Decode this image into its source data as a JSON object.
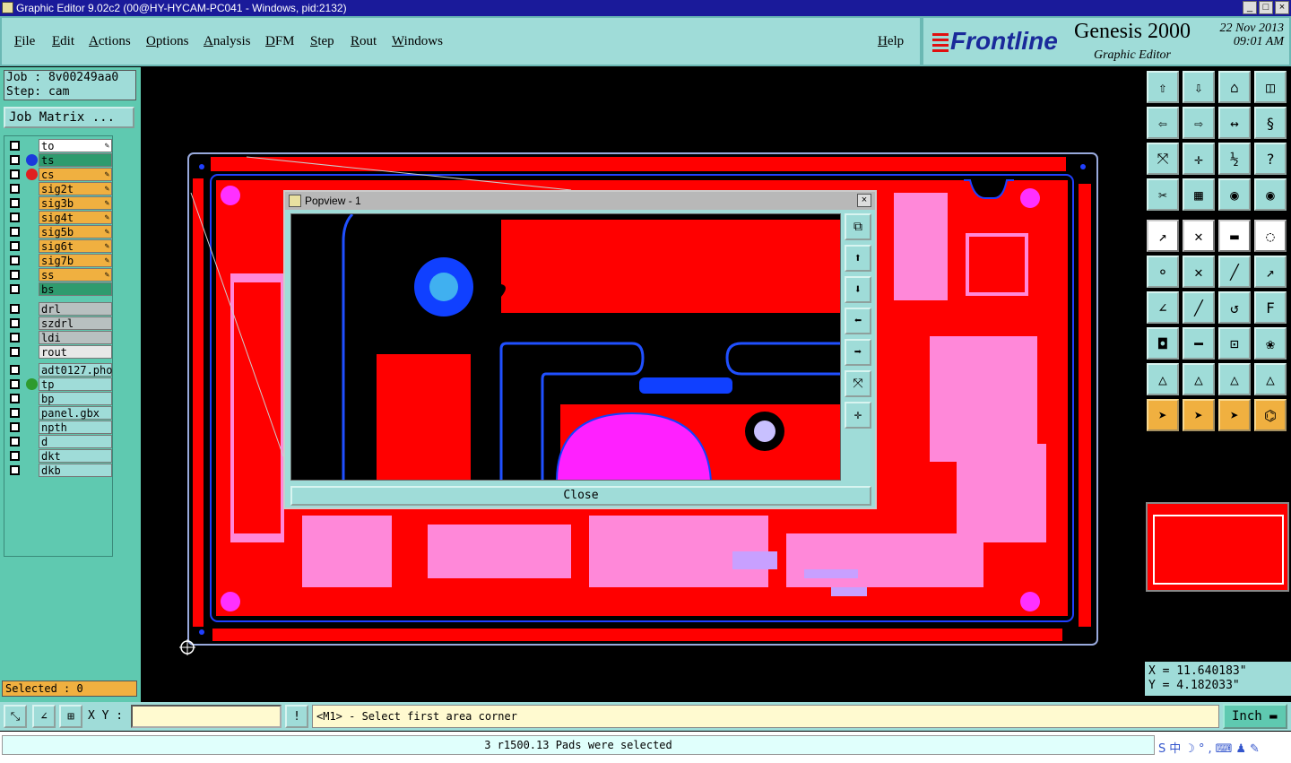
{
  "window": {
    "title": "Graphic Editor 9.02c2 (00@HY-HYCAM-PC041 - Windows, pid:2132)"
  },
  "menu": {
    "items": [
      "File",
      "Edit",
      "Actions",
      "Options",
      "Analysis",
      "DFM",
      "Step",
      "Rout",
      "Windows"
    ],
    "help": "Help"
  },
  "brand": {
    "logo": "Frontline",
    "product": "Genesis 2000",
    "subtitle": "Graphic Editor",
    "date_line1": "22 Nov 2013",
    "date_line2": "09:01 AM"
  },
  "job": {
    "job_line": "Job : 8v00249aa0",
    "step_line": "Step: cam",
    "matrix_button": "Job Matrix ..."
  },
  "layers": [
    {
      "name": "to",
      "color": "#ffffff",
      "dot": "",
      "flag": true
    },
    {
      "name": "ts",
      "color": "#2e9b6e",
      "dot": "#1a3adc",
      "flag": false
    },
    {
      "name": "cs",
      "color": "#f0b040",
      "dot": "#e02020",
      "flag": true
    },
    {
      "name": "sig2t",
      "color": "#f0b040",
      "dot": "",
      "flag": true
    },
    {
      "name": "sig3b",
      "color": "#f0b040",
      "dot": "",
      "flag": true
    },
    {
      "name": "sig4t",
      "color": "#f0b040",
      "dot": "",
      "flag": true
    },
    {
      "name": "sig5b",
      "color": "#f0b040",
      "dot": "",
      "flag": true
    },
    {
      "name": "sig6t",
      "color": "#f0b040",
      "dot": "",
      "flag": true
    },
    {
      "name": "sig7b",
      "color": "#f0b040",
      "dot": "",
      "flag": true
    },
    {
      "name": "ss",
      "color": "#f0b040",
      "dot": "",
      "flag": true
    },
    {
      "name": "bs",
      "color": "#2e9b6e",
      "dot": "",
      "flag": false
    },
    {
      "name": "drl",
      "color": "#b8c0c0",
      "dot": "",
      "flag": false
    },
    {
      "name": "szdrl",
      "color": "#b8c0c0",
      "dot": "",
      "flag": false
    },
    {
      "name": "ldi",
      "color": "#b8c0c0",
      "dot": "",
      "flag": false
    },
    {
      "name": "rout",
      "color": "#e8e8e8",
      "dot": "",
      "flag": false
    },
    {
      "name": "adt0127.pho",
      "color": "#9fdcd8",
      "dot": "",
      "flag": false
    },
    {
      "name": "tp",
      "color": "#9fdcd8",
      "dot": "#2e9b2e",
      "flag": false
    },
    {
      "name": "bp",
      "color": "#9fdcd8",
      "dot": "",
      "flag": false
    },
    {
      "name": "panel.gbx",
      "color": "#9fdcd8",
      "dot": "",
      "flag": false
    },
    {
      "name": "npth",
      "color": "#9fdcd8",
      "dot": "",
      "flag": false
    },
    {
      "name": "d",
      "color": "#9fdcd8",
      "dot": "",
      "flag": false
    },
    {
      "name": "dkt",
      "color": "#9fdcd8",
      "dot": "",
      "flag": false
    },
    {
      "name": "dkb",
      "color": "#9fdcd8",
      "dot": "",
      "flag": false
    }
  ],
  "selected": "Selected : 0",
  "popview": {
    "title": "Popview - 1",
    "close_label": "Close"
  },
  "coords": {
    "x": "X =  11.640183\"",
    "y": "Y =  4.182033\""
  },
  "bottom": {
    "xy_label": "X Y :",
    "prompt": "<M1> - Select first area corner",
    "unit": "Inch",
    "status": "3 r1500.13 Pads were selected"
  },
  "tools": [
    "home-icon",
    "save-view-icon",
    "house-icon",
    "split-icon",
    "arrow-left-icon",
    "arrow-right-icon",
    "swap-icon",
    "s-icon",
    "fit-icon",
    "center-icon",
    "ratio-icon",
    "help-icon",
    "tweezers-icon",
    "grid-icon",
    "layers-icon",
    "layers-red-icon",
    "measure-icon",
    "snap-icon",
    "ruler-icon",
    "target-icon",
    "connect-icon",
    "cross-icon",
    "line-icon",
    "line-arrow-icon",
    "angle-icon",
    "slash-icon",
    "arc-icon",
    "ff-icon",
    "pad-icon",
    "minus-icon",
    "dim-icon",
    "flower-icon",
    "tri-icon",
    "a-tri-icon",
    "a-tri2-icon",
    "a-tri3-icon",
    "pointer-icon",
    "pointer-box-icon",
    "pointer-select-icon",
    "net-icon"
  ],
  "colors": {
    "board": "#ff0000",
    "pad": "#ff20ff",
    "trace": "#1040ff",
    "panel": "#9fdcd8"
  }
}
